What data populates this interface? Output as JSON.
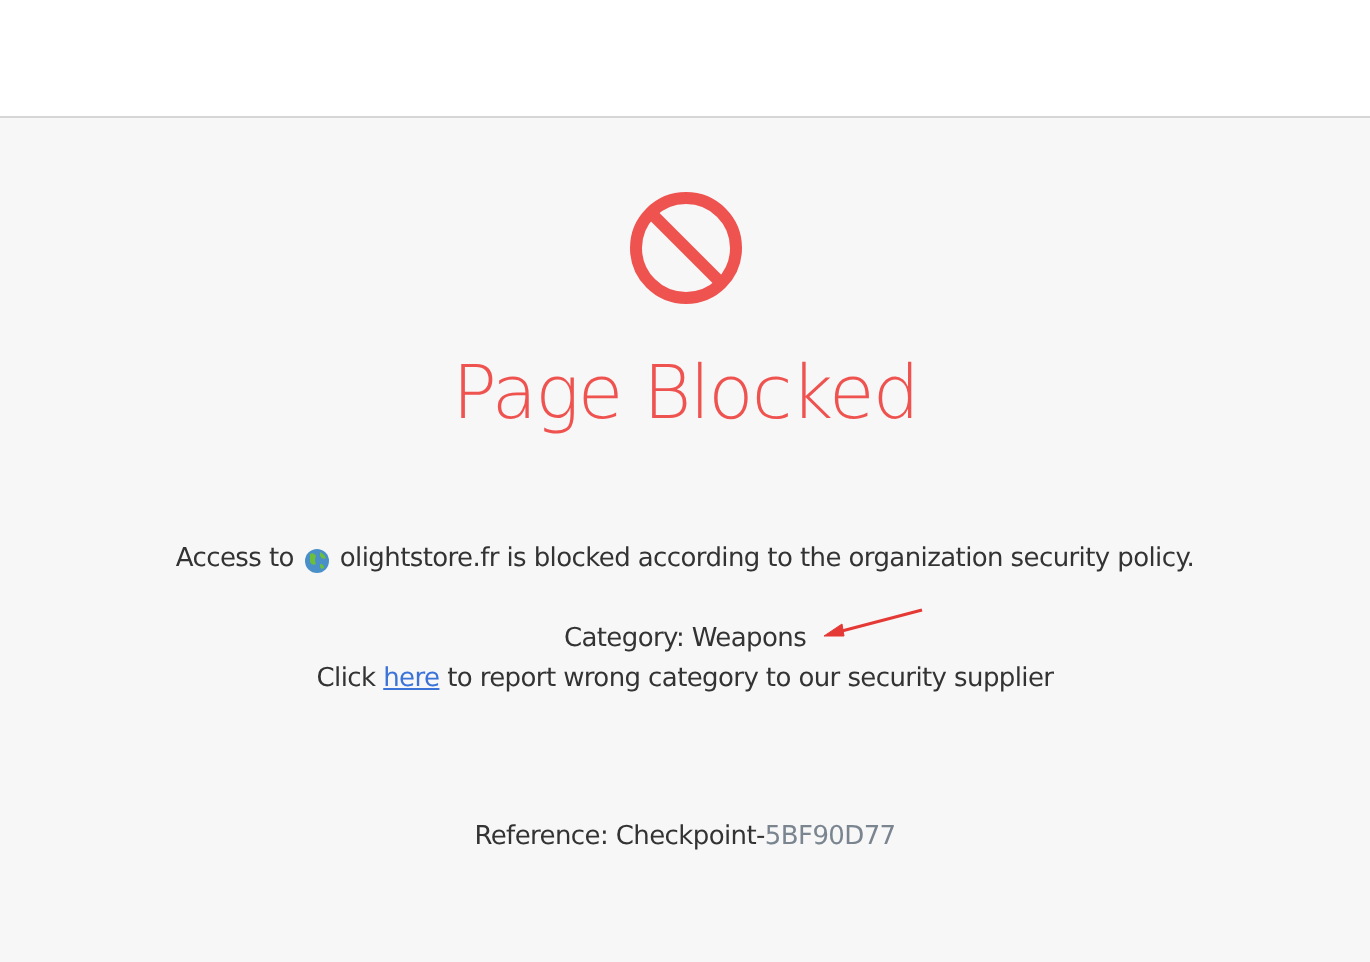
{
  "title": "Page Blocked",
  "access": {
    "prefix": "Access to",
    "message": "olightstore.fr is blocked according to the organization security policy."
  },
  "category": "Category: Weapons",
  "report": {
    "before": "Click",
    "link": "here",
    "after": "to report wrong category to our security supplier"
  },
  "reference": {
    "label": "Reference: Checkpoint-",
    "code": "5BF90D77"
  }
}
